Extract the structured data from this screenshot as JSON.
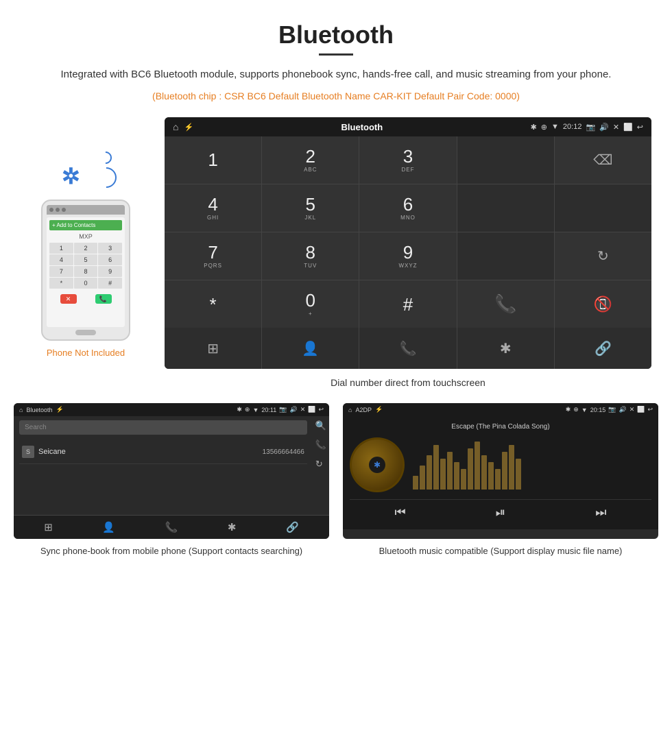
{
  "header": {
    "title": "Bluetooth",
    "description": "Integrated with BC6 Bluetooth module, supports phonebook sync, hands-free call, and music streaming from your phone.",
    "specs": "(Bluetooth chip : CSR BC6    Default Bluetooth Name CAR-KIT    Default Pair Code: 0000)"
  },
  "phone_label": "Phone Not Included",
  "dialer": {
    "statusbar": {
      "app_name": "Bluetooth",
      "time": "20:12"
    },
    "keys": [
      {
        "main": "1",
        "sub": ""
      },
      {
        "main": "2",
        "sub": "ABC"
      },
      {
        "main": "3",
        "sub": "DEF"
      },
      {
        "main": "",
        "sub": ""
      },
      {
        "main": "⌫",
        "sub": ""
      },
      {
        "main": "4",
        "sub": "GHI"
      },
      {
        "main": "5",
        "sub": "JKL"
      },
      {
        "main": "6",
        "sub": "MNO"
      },
      {
        "main": "",
        "sub": ""
      },
      {
        "main": "",
        "sub": ""
      },
      {
        "main": "7",
        "sub": "PQRS"
      },
      {
        "main": "8",
        "sub": "TUV"
      },
      {
        "main": "9",
        "sub": "WXYZ"
      },
      {
        "main": "",
        "sub": ""
      },
      {
        "main": "↻",
        "sub": ""
      },
      {
        "main": "*",
        "sub": ""
      },
      {
        "main": "0",
        "sub": "+"
      },
      {
        "main": "#",
        "sub": ""
      },
      {
        "main": "📞",
        "sub": ""
      },
      {
        "main": "📵",
        "sub": ""
      }
    ],
    "bottom_icons": [
      "⊞",
      "👤",
      "📞",
      "✱",
      "🔗"
    ],
    "caption": "Dial number direct from touchscreen"
  },
  "phonebook_screen": {
    "statusbar_app": "Bluetooth",
    "time": "20:11",
    "search_placeholder": "Search",
    "contact": {
      "letter": "S",
      "name": "Seicane",
      "phone": "13566664466"
    },
    "caption": "Sync phone-book from mobile phone\n(Support contacts searching)"
  },
  "music_screen": {
    "statusbar_app": "A2DP",
    "time": "20:15",
    "song_title": "Escape (The Pina Colada Song)",
    "eq_heights": [
      20,
      35,
      50,
      65,
      45,
      55,
      40,
      30,
      60,
      70,
      50,
      40,
      30,
      55,
      65,
      45
    ],
    "caption": "Bluetooth music compatible\n(Support display music file name)"
  },
  "icons": {
    "home": "⌂",
    "bluetooth": "✱",
    "usb": "⚡",
    "camera": "📷",
    "volume": "🔊",
    "close": "✕",
    "window": "⬜",
    "back": "↩",
    "search": "🔍",
    "call": "📞",
    "refresh": "↻",
    "grid": "⊞",
    "person": "👤",
    "link": "🔗",
    "skip_back": "⏮",
    "play_pause": "⏯",
    "skip_forward": "⏭"
  },
  "colors": {
    "orange": "#e67e22",
    "blue": "#3a7bd5",
    "dark_bg": "#2a2a2a",
    "call_green": "#4CAF50",
    "call_red": "#e74c3c"
  }
}
